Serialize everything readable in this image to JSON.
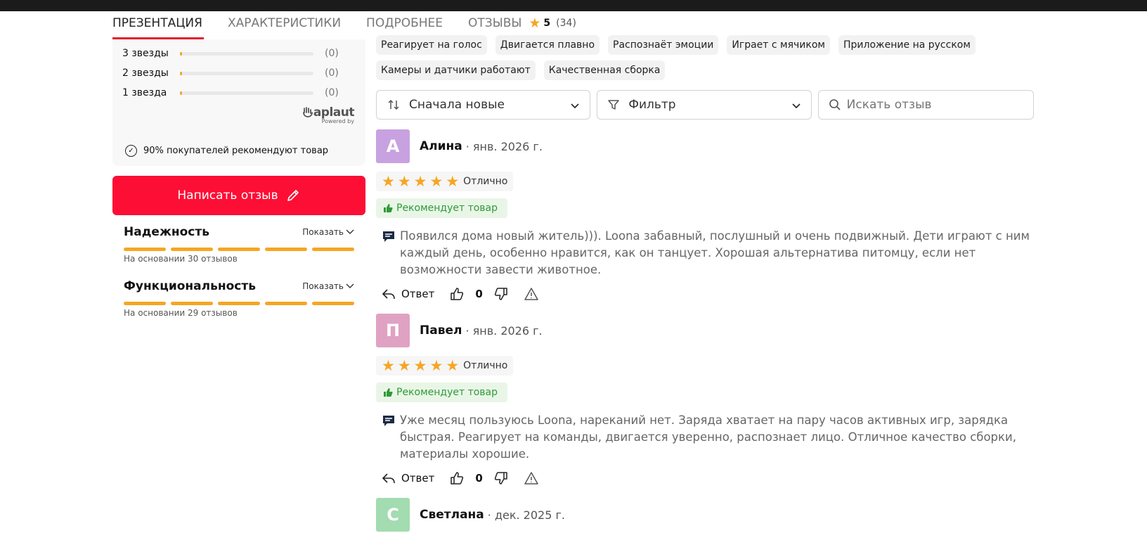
{
  "tabs": [
    {
      "label": "ПРЕЗЕНТАЦИЯ",
      "active": true
    },
    {
      "label": "ХАРАКТЕРИСТИКИ",
      "active": false
    },
    {
      "label": "ПОДРОБНЕЕ",
      "active": false
    },
    {
      "label": "ОТЗЫВЫ",
      "active": false
    }
  ],
  "tab_rating": {
    "value": "5",
    "count": "(34)"
  },
  "ratings": [
    {
      "label": "3 звезды",
      "count": "(0)",
      "fraction": 0
    },
    {
      "label": "2 звезды",
      "count": "(0)",
      "fraction": 0
    },
    {
      "label": "1 звезда",
      "count": "(0)",
      "fraction": 0
    }
  ],
  "branding": {
    "name": "aplaut",
    "powered_by": "Powered by"
  },
  "recommend_text": "90% покупателей рекомендуют товар",
  "write_review_label": "Написать отзыв",
  "criteria": [
    {
      "title": "Надежность",
      "show_label": "Показать",
      "note": "На основании 30 отзывов",
      "segments_filled": 5
    },
    {
      "title": "Функциональность",
      "show_label": "Показать",
      "note": "На основании 29 отзывов",
      "segments_filled": 5
    }
  ],
  "chips": [
    "Реагирует на голос",
    "Двигается плавно",
    "Распознаёт эмоции",
    "Играет с мячиком",
    "Приложение на русском",
    "Камеры и датчики работают",
    "Качественная сборка"
  ],
  "controls": {
    "sort_label": "Сначала новые",
    "filter_label": "Фильтр",
    "search_placeholder": "Искать отзыв"
  },
  "reviews": [
    {
      "initial": "А",
      "avatar_color": "#c8a2e0",
      "name": "Алина",
      "date": "· янв. 2026 г.",
      "rating": 5,
      "rating_label": "Отлично",
      "recommend_label": "Рекомендует товар",
      "text": "Появился дома новый житель))). Loona забавный, послушный и очень подвижный. Дети играют с ним каждый день, особенно нравится, как он танцует. Хорошая альтернатива питомцу, если нет возможности завести животное.",
      "reply_label": "Ответ",
      "votes": "0"
    },
    {
      "initial": "П",
      "avatar_color": "#e0a2c3",
      "name": "Павел",
      "date": "· янв. 2026 г.",
      "rating": 5,
      "rating_label": "Отлично",
      "recommend_label": "Рекомендует товар",
      "text": "Уже месяц пользуюсь Loona, нареканий нет. Заряда хватает на пару часов активных игр, зарядка быстрая. Реагирует на команды, двигается уверенно, распознает лицо. Отличное качество сборки, материалы хорошие.",
      "reply_label": "Ответ",
      "votes": "0"
    },
    {
      "initial": "С",
      "avatar_color": "#a2dcb0",
      "name": "Светлана",
      "date": "· дек. 2025 г."
    }
  ],
  "colors": {
    "accent": "#fd0e35",
    "star": "#f5a623",
    "recommend_green": "#2f9a38"
  }
}
